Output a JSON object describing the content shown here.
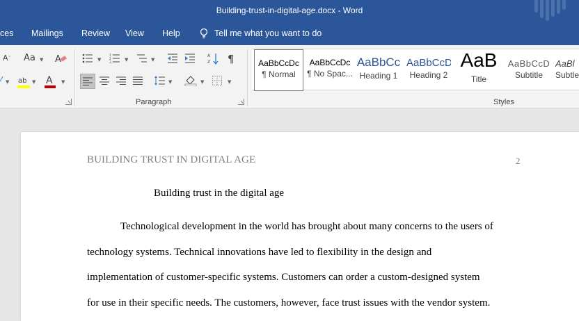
{
  "window": {
    "title": "Building-trust-in-digital-age.docx  -  Word"
  },
  "menu": {
    "tabs": [
      "ces",
      "Mailings",
      "Review",
      "View",
      "Help"
    ],
    "tell_me": "Tell me what you want to do"
  },
  "ribbon": {
    "paragraph_label": "Paragraph",
    "styles_label": "Styles",
    "font_case_label": "Aa",
    "styles": [
      {
        "preview": "AaBbCcDc",
        "name": "¶ Normal"
      },
      {
        "preview": "AaBbCcDc",
        "name": "¶ No Spac..."
      },
      {
        "preview": "AaBbCc",
        "name": "Heading 1"
      },
      {
        "preview": "AaBbCcD",
        "name": "Heading 2"
      },
      {
        "preview": "AaB",
        "name": "Title"
      },
      {
        "preview": "AaBbCcD",
        "name": "Subtitle"
      },
      {
        "preview": "AaBl",
        "name": "Subtle"
      }
    ],
    "colors": {
      "highlight": "#ffff00",
      "font_color": "#c00000",
      "accent": "#2b579a"
    }
  },
  "document": {
    "header": "BUILDING TRUST IN DIGITAL AGE",
    "page_number": "2",
    "title": "Building trust in the digital age",
    "lines": [
      "Technological development in the world has brought about many concerns to the users of",
      "technology systems. Technical innovations have led to flexibility in the design and",
      "implementation of customer-specific systems. Customers can order a custom-designed system",
      "for use in their specific needs. The customers, however, face trust issues with the vendor system."
    ]
  }
}
